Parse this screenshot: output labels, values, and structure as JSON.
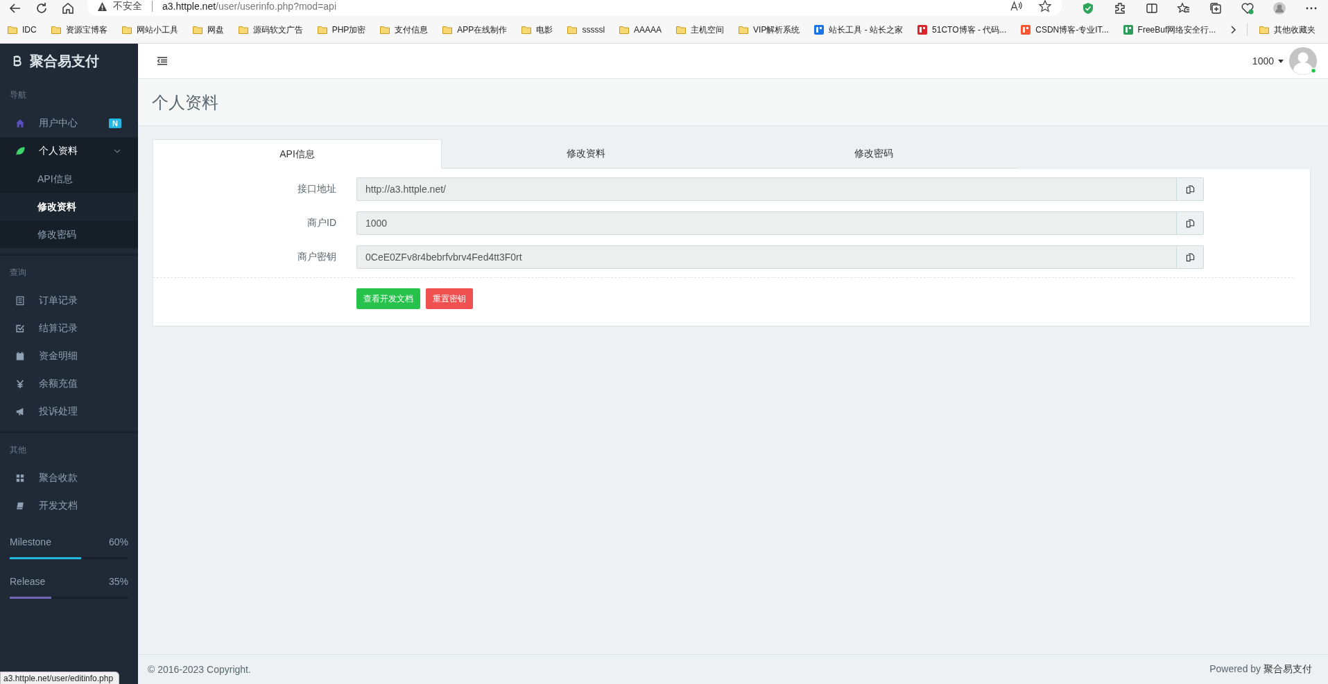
{
  "browser": {
    "security_label": "不安全",
    "url_host": "a3.httple.net",
    "url_path": "/user/userinfo.php?mod=api",
    "bookmarks": [
      {
        "label": "IDC",
        "kind": "folder"
      },
      {
        "label": "资源宝博客",
        "kind": "folder"
      },
      {
        "label": "网站小工具",
        "kind": "folder"
      },
      {
        "label": "网盘",
        "kind": "folder"
      },
      {
        "label": "源码软文广告",
        "kind": "folder"
      },
      {
        "label": "PHP加密",
        "kind": "folder"
      },
      {
        "label": "支付信息",
        "kind": "folder"
      },
      {
        "label": "APP在线制作",
        "kind": "folder"
      },
      {
        "label": "电影",
        "kind": "folder"
      },
      {
        "label": "sssssl",
        "kind": "folder"
      },
      {
        "label": "AAAAA",
        "kind": "folder"
      },
      {
        "label": "主机空间",
        "kind": "folder"
      },
      {
        "label": "VIP解析系统",
        "kind": "folder"
      },
      {
        "label": "站长工具 - 站长之家",
        "kind": "site",
        "color": "#1a73e8"
      },
      {
        "label": "51CTO博客 - 代码...",
        "kind": "site",
        "color": "#d9252b"
      },
      {
        "label": "CSDN博客-专业IT...",
        "kind": "site",
        "color": "#fc5531"
      },
      {
        "label": "FreeBuf网络安全行...",
        "kind": "site",
        "color": "#2e9d5b"
      }
    ],
    "other_bookmarks": "其他收藏夹",
    "status_url": "a3.httple.net/user/editinfo.php"
  },
  "sidebar": {
    "brand": "聚合易支付",
    "sections": [
      {
        "heading": "导航",
        "items": [
          {
            "label": "用户中心",
            "selected": false,
            "badge": "N"
          },
          {
            "label": "个人资料",
            "selected": true,
            "expanded": true,
            "children": [
              {
                "label": "API信息",
                "selected": false
              },
              {
                "label": "修改资料",
                "selected": true
              },
              {
                "label": "修改密码",
                "selected": false
              }
            ]
          }
        ]
      },
      {
        "heading": "查询",
        "items": [
          {
            "label": "订单记录",
            "selected": false
          },
          {
            "label": "结算记录",
            "selected": false
          },
          {
            "label": "资金明细",
            "selected": false
          },
          {
            "label": "余额充值",
            "selected": false
          },
          {
            "label": "投诉处理",
            "selected": false
          }
        ]
      },
      {
        "heading": "其他",
        "items": [
          {
            "label": "聚合收款",
            "selected": false
          },
          {
            "label": "开发文档",
            "selected": false
          }
        ]
      }
    ],
    "progress": [
      {
        "label": "Milestone",
        "reading": "60%",
        "level": 0.6,
        "color": "#23b7e5"
      },
      {
        "label": "Release",
        "reading": "35%",
        "level": 0.35,
        "color": "#7266ba"
      }
    ]
  },
  "header": {
    "user": "1000"
  },
  "page_title": "个人资料",
  "tabs": [
    {
      "label": "API信息",
      "selected": true
    },
    {
      "label": "修改资料",
      "selected": false
    },
    {
      "label": "修改密码",
      "selected": false
    }
  ],
  "fields": [
    {
      "label": "接口地址",
      "value": "http://a3.httple.net/"
    },
    {
      "label": "商户ID",
      "value": "1000"
    },
    {
      "label": "商户密钥",
      "value": "0CeE0ZFv8r4bebrfvbrv4Fed4tt3F0rt"
    }
  ],
  "buttons": [
    {
      "label": "查看开发文档",
      "kind": "primary"
    },
    {
      "label": "重置密钥",
      "kind": "danger"
    }
  ],
  "footer": {
    "copyright": "© 2016-2023 Copyright.",
    "powered_by": "Powered by",
    "brand": "聚合易支付"
  }
}
